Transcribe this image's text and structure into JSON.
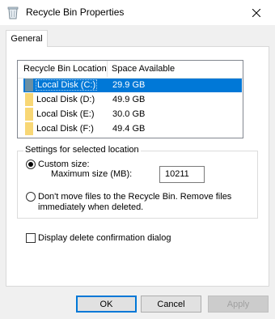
{
  "window": {
    "title": "Recycle Bin Properties"
  },
  "tabs": [
    {
      "label": "General"
    }
  ],
  "list": {
    "columns": [
      "Recycle Bin Location",
      "Space Available"
    ],
    "rows": [
      {
        "location": "Local Disk (C:)",
        "space": "29.9 GB",
        "selected": true
      },
      {
        "location": "Local Disk (D:)",
        "space": "49.9 GB",
        "selected": false
      },
      {
        "location": "Local Disk (E:)",
        "space": "30.0 GB",
        "selected": false
      },
      {
        "location": "Local Disk (F:)",
        "space": "49.4 GB",
        "selected": false
      }
    ]
  },
  "settings": {
    "group_label": "Settings for selected location",
    "custom_size_label": "Custom size:",
    "max_size_label": "Maximum size (MB):",
    "max_size_value": "10211",
    "dont_move_line1": "Don't move files to the Recycle Bin. Remove files",
    "dont_move_line2": "immediately when deleted.",
    "selected_option": "custom"
  },
  "confirm": {
    "label": "Display delete confirmation dialog",
    "checked": false
  },
  "buttons": {
    "ok": "OK",
    "cancel": "Cancel",
    "apply": "Apply"
  },
  "colors": {
    "selection": "#0078d7",
    "folder": "#f8d775",
    "drive": "#6a8fa3"
  },
  "icons": {
    "title": "recycle-bin-icon",
    "close": "close-icon",
    "folder": "folder-icon",
    "drive": "drive-icon"
  }
}
